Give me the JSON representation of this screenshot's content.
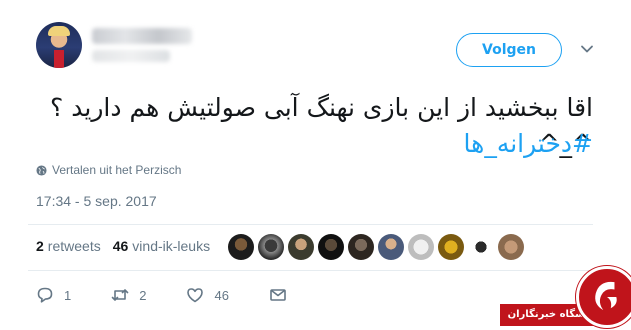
{
  "header": {
    "follow_label": "Volgen"
  },
  "tweet": {
    "text": "اقا ببخشید از این بازی نهنگ آبی صولتیش هم دارید ؟ ^_^",
    "hashtag": "#دخترانه_ها",
    "translate_label": "Vertalen uit het Perzisch",
    "timestamp": "17:34 - 5 sep. 2017"
  },
  "stats": {
    "retweets_count": "2",
    "retweets_label": "retweets",
    "likes_count": "46",
    "likes_label": "vind-ik-leuks"
  },
  "actions": {
    "reply_count": "1",
    "retweet_count": "2",
    "like_count": "46"
  },
  "watermark": {
    "text": "باشگاه خبرنگاران"
  },
  "colors": {
    "accent": "#1da1f2",
    "muted": "#657786",
    "watermark_red": "#c0141b"
  },
  "icons": [
    "chevron-down-icon",
    "globe-icon",
    "reply-icon",
    "retweet-icon",
    "heart-icon",
    "message-icon"
  ]
}
